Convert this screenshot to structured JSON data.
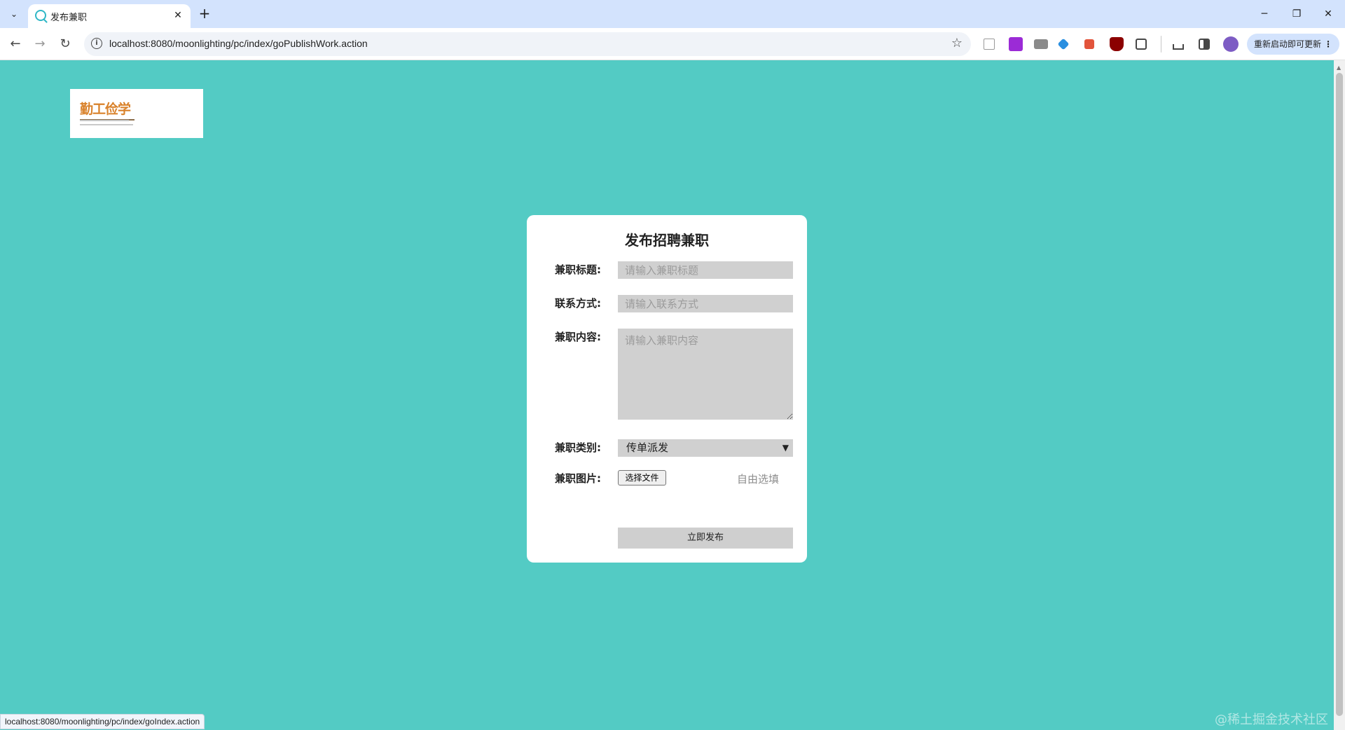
{
  "browser": {
    "tab_title": "发布兼职",
    "url": "localhost:8080/moonlighting/pc/index/goPublishWork.action",
    "update_button": "重新启动即可更新",
    "status_url": "localhost:8080/moonlighting/pc/index/goIndex.action"
  },
  "logo": {
    "text": "勤工俭学"
  },
  "form": {
    "title": "发布招聘兼职",
    "job_title": {
      "label": "兼职标题:",
      "placeholder": "请输入兼职标题"
    },
    "contact": {
      "label": "联系方式:",
      "placeholder": "请输入联系方式"
    },
    "content": {
      "label": "兼职内容:",
      "placeholder": "请输入兼职内容"
    },
    "category": {
      "label": "兼职类别:",
      "selected": "传单派发"
    },
    "image": {
      "label": "兼职图片:",
      "choose_file": "选择文件",
      "hint": "自由选填"
    },
    "submit": "立即发布"
  },
  "watermark": "@稀土掘金技术社区",
  "colors": {
    "page_bg": "#53cbc4",
    "card_bg": "#ffffff",
    "field_bg": "#d0d0d0",
    "accent_logo": "#d9822b"
  }
}
